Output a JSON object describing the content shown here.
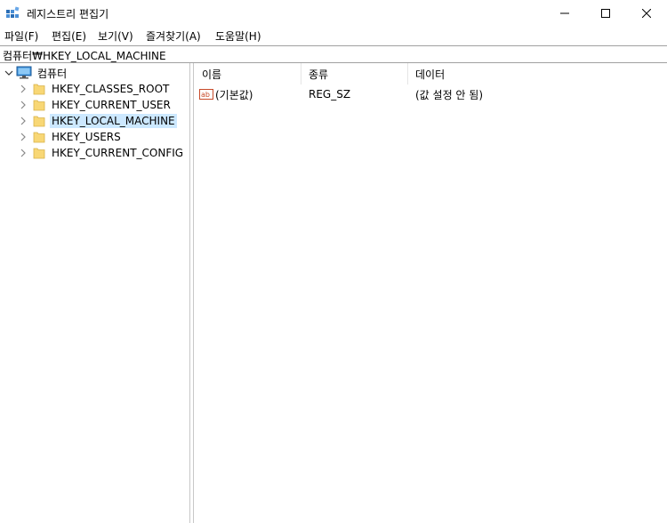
{
  "window": {
    "title": "레지스트리 편집기"
  },
  "menu": [
    "파일(F)",
    "편집(E)",
    "보기(V)",
    "즐겨찾기(A)",
    "도움말(H)"
  ],
  "address": "컴퓨터₩HKEY_LOCAL_MACHINE",
  "tree": {
    "root": "컴퓨터",
    "children": [
      "HKEY_CLASSES_ROOT",
      "HKEY_CURRENT_USER",
      "HKEY_LOCAL_MACHINE",
      "HKEY_USERS",
      "HKEY_CURRENT_CONFIG"
    ],
    "selected_index": 2
  },
  "list": {
    "columns": [
      "이름",
      "종류",
      "데이터"
    ],
    "rows": [
      {
        "name": "(기본값)",
        "type": "REG_SZ",
        "data": "(값 설정 안 됨)",
        "icon": "string-value-icon"
      }
    ]
  },
  "colors": {
    "selection": "#cce8ff",
    "folder": "#f8d775"
  }
}
